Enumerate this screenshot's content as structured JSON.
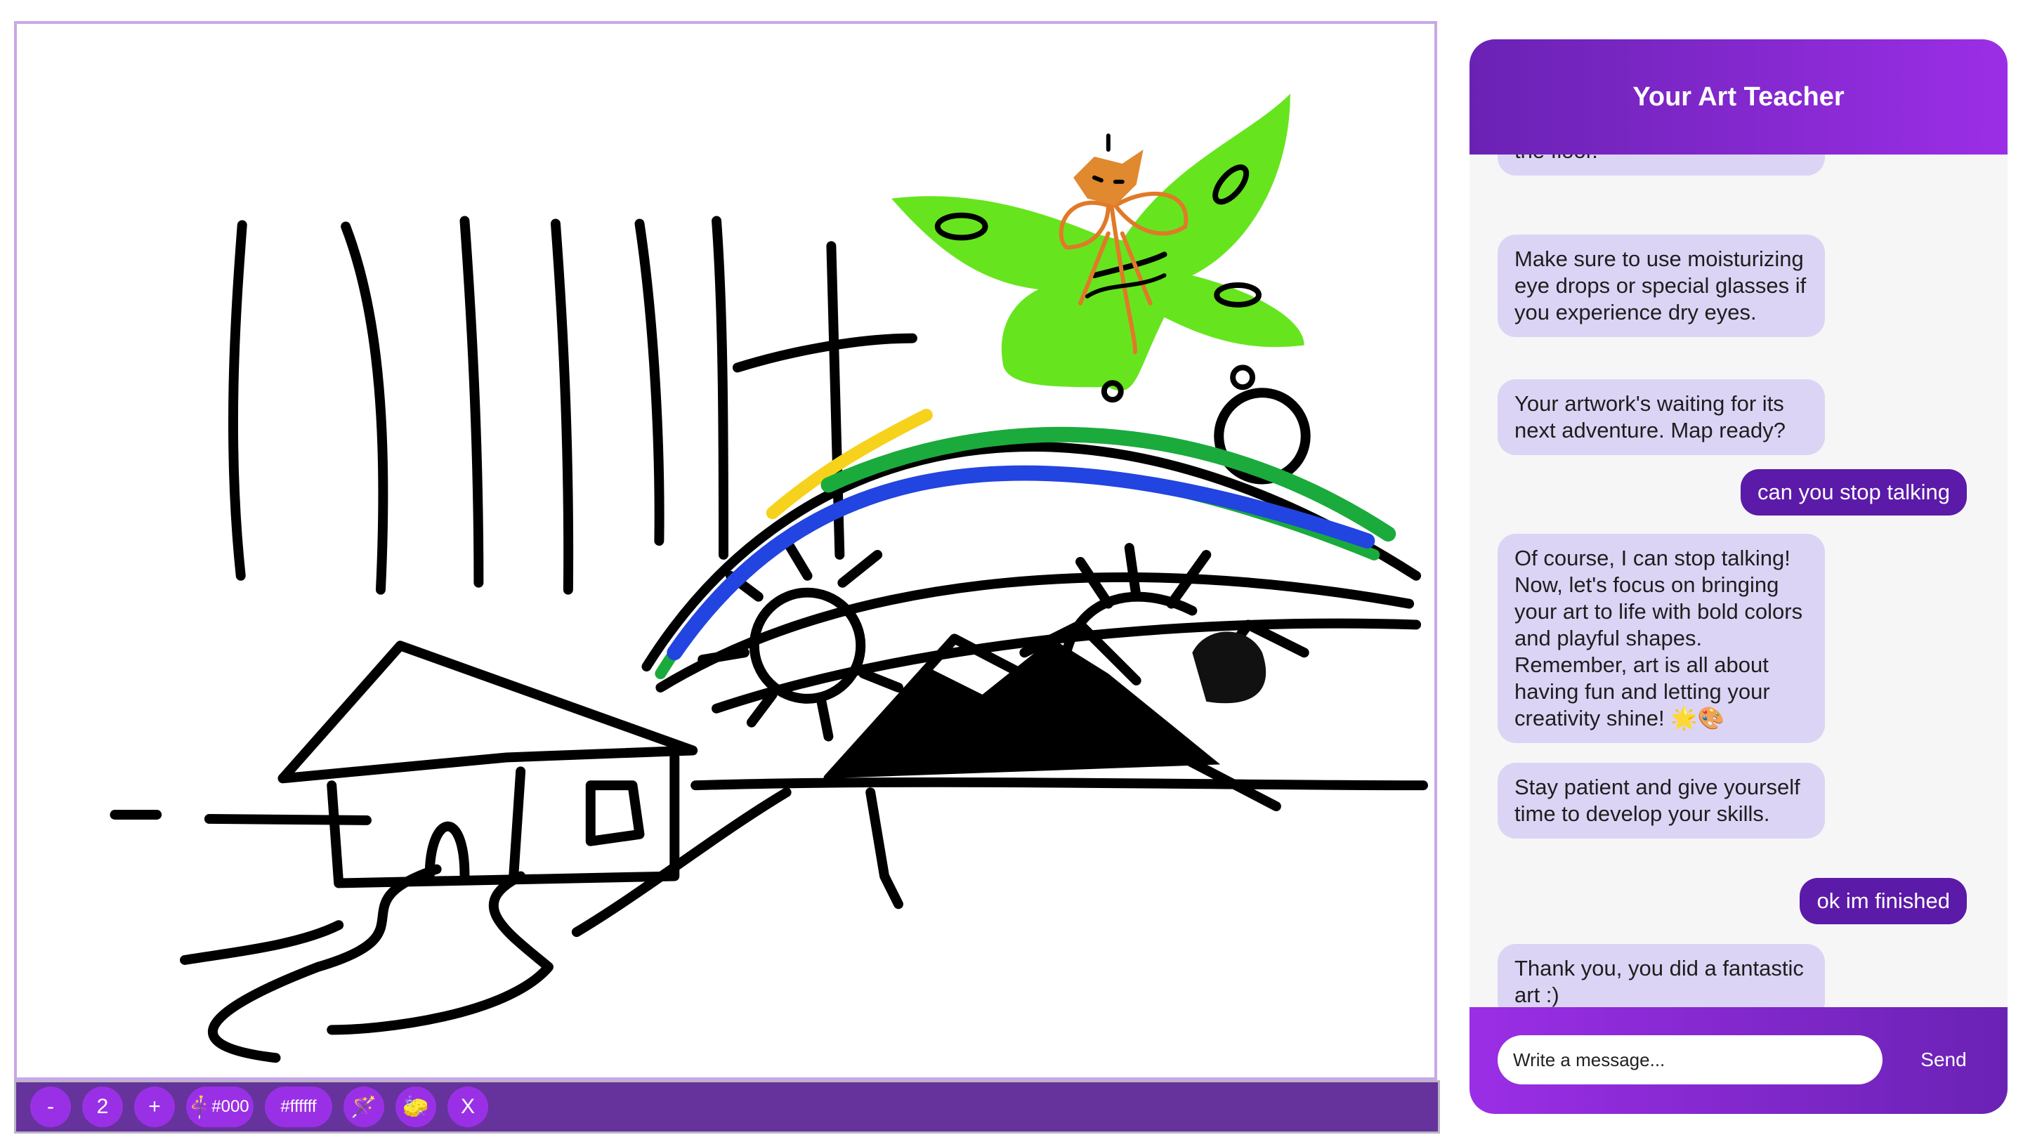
{
  "toolbar": {
    "minus_label": "-",
    "brush_size": "2",
    "plus_label": "+",
    "color_primary": "#000",
    "color_secondary": "#ffffff",
    "clear_label": "X"
  },
  "chat": {
    "title": "Your Art Teacher",
    "messages": [
      {
        "role": "bot",
        "text": "the floor."
      },
      {
        "role": "bot",
        "text": "Make sure to use moisturizing eye drops or special glasses if you experience dry eyes."
      },
      {
        "role": "bot",
        "text": "Your artwork's waiting for its next adventure. Map ready?"
      },
      {
        "role": "user",
        "text": "can you stop talking"
      },
      {
        "role": "bot",
        "text": "Of course, I can stop talking! Now, let's focus on bringing your art to life with bold colors and playful shapes. Remember, art is all about having fun and letting your creativity shine! 🌟🎨"
      },
      {
        "role": "bot",
        "text": "Stay patient and give yourself time to develop your skills."
      },
      {
        "role": "user",
        "text": "ok im finished"
      },
      {
        "role": "bot",
        "text": "Thank you, you did a fantastic art :)"
      }
    ],
    "input_placeholder": "Write a message...",
    "send_label": "Send"
  },
  "colors": {
    "accent": "#9a30e6",
    "toolbar_bg": "#65339b",
    "user_bubble": "#5b1aa8",
    "bot_bubble": "#dcd4f5"
  }
}
